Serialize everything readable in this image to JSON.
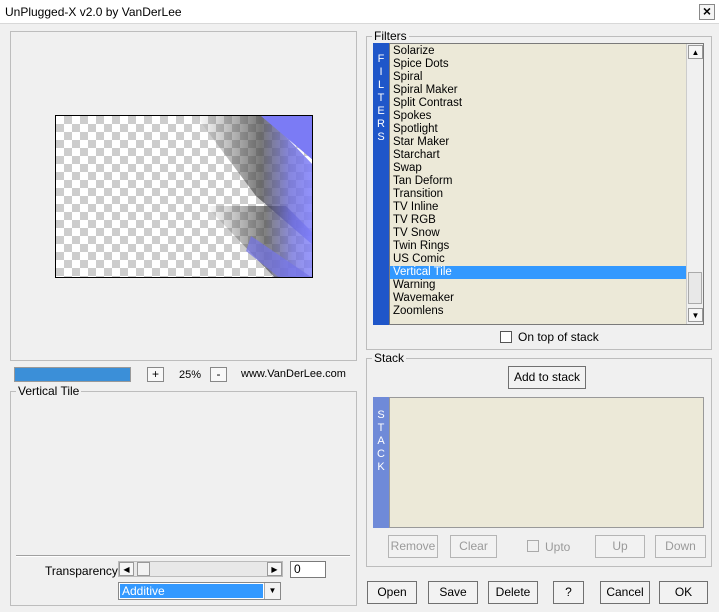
{
  "window": {
    "title": "UnPlugged-X v2.0 by VanDerLee",
    "close_glyph": "×"
  },
  "preview": {
    "progress_percent": 100,
    "zoom_minus": "-",
    "zoom_plus": "+",
    "zoom_level": "25%",
    "website": "www.VanDerLee.com"
  },
  "settings": {
    "group_title": "Vertical Tile",
    "transparency_label": "Transparency",
    "transparency_value": "0",
    "blend_mode": "Additive"
  },
  "filters": {
    "group_title": "Filters",
    "side_label": [
      "F",
      "I",
      "L",
      "T",
      "E",
      "R",
      "S"
    ],
    "items": [
      "Solarize",
      "Spice Dots",
      "Spiral",
      "Spiral Maker",
      "Split Contrast",
      "Spokes",
      "Spotlight",
      "Star Maker",
      "Starchart",
      "Swap",
      "Tan Deform",
      "Transition",
      "TV Inline",
      "TV RGB",
      "TV Snow",
      "Twin Rings",
      "US Comic",
      "Vertical Tile",
      "Warning",
      "Wavemaker",
      "Zoomlens"
    ],
    "selected": "Vertical Tile",
    "on_top_label": "On top of stack"
  },
  "stack": {
    "group_title": "Stack",
    "side_label": [
      "S",
      "T",
      "A",
      "C",
      "K"
    ],
    "add_label": "Add to stack",
    "remove_label": "Remove",
    "clear_label": "Clear",
    "upto_label": "Upto",
    "up_label": "Up",
    "down_label": "Down"
  },
  "footer": {
    "open_label": "Open",
    "save_label": "Save",
    "delete_label": "Delete",
    "help_label": "?",
    "cancel_label": "Cancel",
    "ok_label": "OK"
  },
  "colors": {
    "selection": "#3399ff",
    "filters_strip": "#1f56c9",
    "stack_strip": "#6f8ad8",
    "list_bg": "#ece9d8"
  }
}
